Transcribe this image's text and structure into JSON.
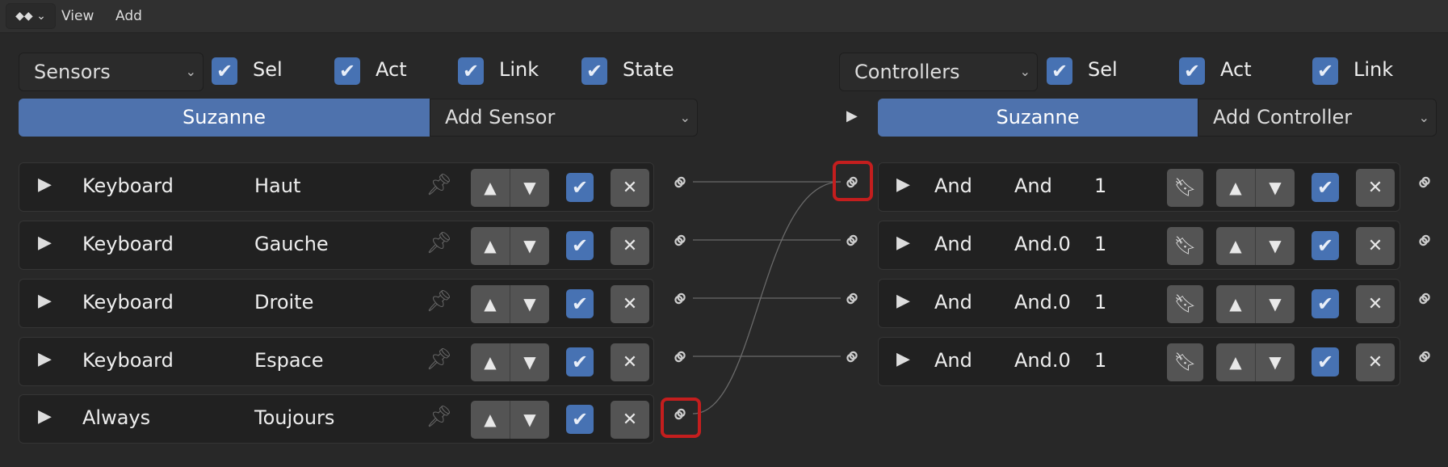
{
  "menubar": {
    "editor_icon": "logic-editor-icon",
    "items": [
      "View",
      "Add"
    ]
  },
  "sensors": {
    "dropdown": "Sensors",
    "filters": [
      {
        "label": "Sel",
        "checked": true
      },
      {
        "label": "Act",
        "checked": true
      },
      {
        "label": "Link",
        "checked": true
      },
      {
        "label": "State",
        "checked": true
      }
    ],
    "object": "Suzanne",
    "add_label": "Add Sensor",
    "rows": [
      {
        "type": "Keyboard",
        "name": "Haut",
        "enabled": true
      },
      {
        "type": "Keyboard",
        "name": "Gauche",
        "enabled": true
      },
      {
        "type": "Keyboard",
        "name": "Droite",
        "enabled": true
      },
      {
        "type": "Keyboard",
        "name": "Espace",
        "enabled": true
      },
      {
        "type": "Always",
        "name": "Toujours",
        "enabled": true,
        "highlighted": true
      }
    ]
  },
  "controllers": {
    "dropdown": "Controllers",
    "filters": [
      {
        "label": "Sel",
        "checked": true
      },
      {
        "label": "Act",
        "checked": true
      },
      {
        "label": "Link",
        "checked": true
      }
    ],
    "object": "Suzanne",
    "add_label": "Add Controller",
    "rows": [
      {
        "type": "And",
        "name": "And",
        "state": "1",
        "enabled": true,
        "input_highlighted": true
      },
      {
        "type": "And",
        "name": "And.0",
        "state": "1",
        "enabled": true
      },
      {
        "type": "And",
        "name": "And.0",
        "state": "1",
        "enabled": true
      },
      {
        "type": "And",
        "name": "And.0",
        "state": "1",
        "enabled": true
      }
    ]
  },
  "connections": [
    [
      0,
      0
    ],
    [
      1,
      1
    ],
    [
      2,
      2
    ],
    [
      3,
      3
    ],
    [
      4,
      0
    ]
  ],
  "colors": {
    "accent": "#4772b3",
    "highlight": "#c41e1e"
  }
}
